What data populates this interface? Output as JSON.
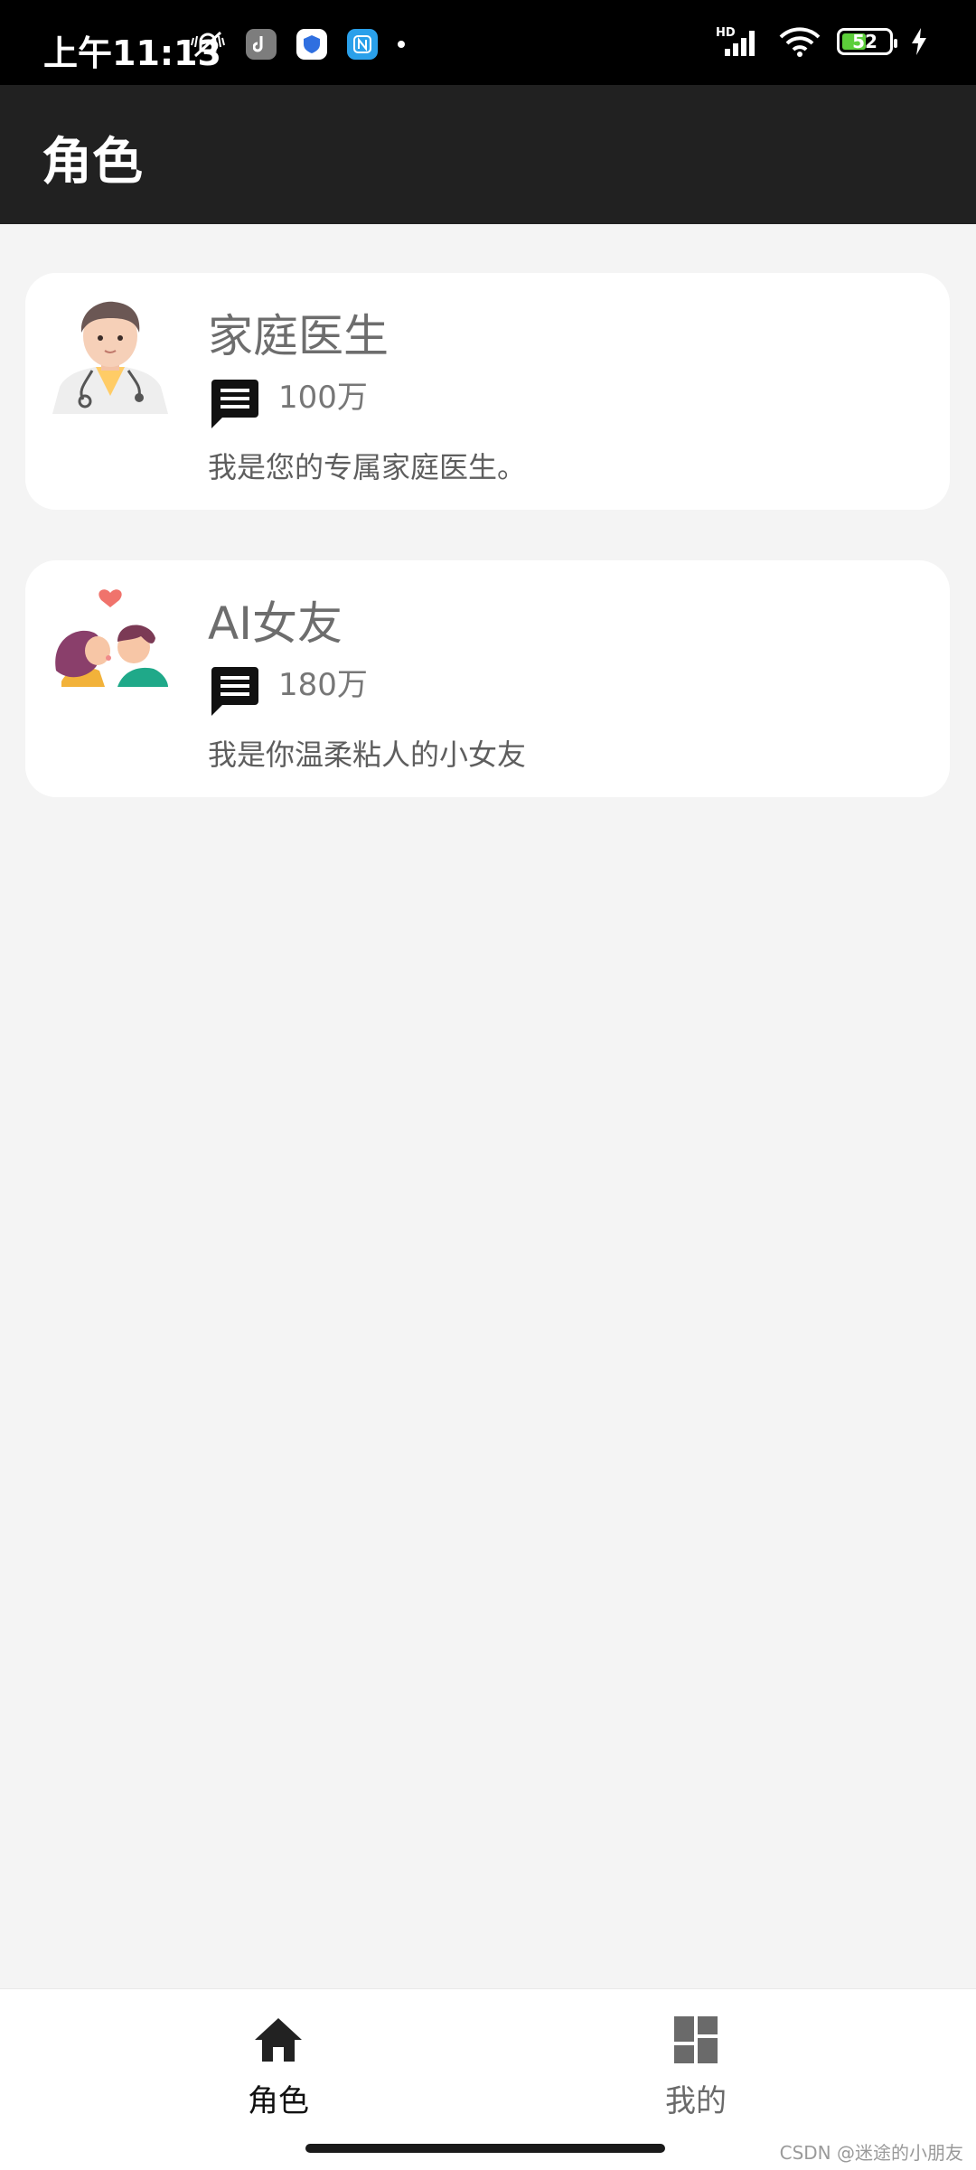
{
  "status_bar": {
    "time": "上午11:13",
    "battery": "52",
    "battery_level": 0.52,
    "network_badge": "HD",
    "icons": [
      "mute-vibrate-icon",
      "app-notification-icon",
      "security-shield-icon",
      "nfc-icon",
      "more-notifications-dot",
      "signal-icon",
      "wifi-icon",
      "battery-icon",
      "charging-icon"
    ]
  },
  "app_bar": {
    "title": "角色"
  },
  "roles": [
    {
      "name": "家庭医生",
      "count": "100万",
      "description": "我是您的专属家庭医生。",
      "avatar": "doctor-avatar"
    },
    {
      "name": "AI女友",
      "count": "180万",
      "description": "我是你温柔粘人的小女友",
      "avatar": "couple-avatar"
    }
  ],
  "bottom_nav": {
    "items": [
      {
        "label": "角色",
        "icon": "home-icon",
        "active": true
      },
      {
        "label": "我的",
        "icon": "dashboard-icon",
        "active": false
      }
    ]
  },
  "watermark": "CSDN @迷途的小朋友",
  "colors": {
    "app_bar_bg": "#212121",
    "page_bg": "#f4f4f4",
    "card_bg": "#ffffff",
    "battery_green": "#5ccf3a"
  }
}
